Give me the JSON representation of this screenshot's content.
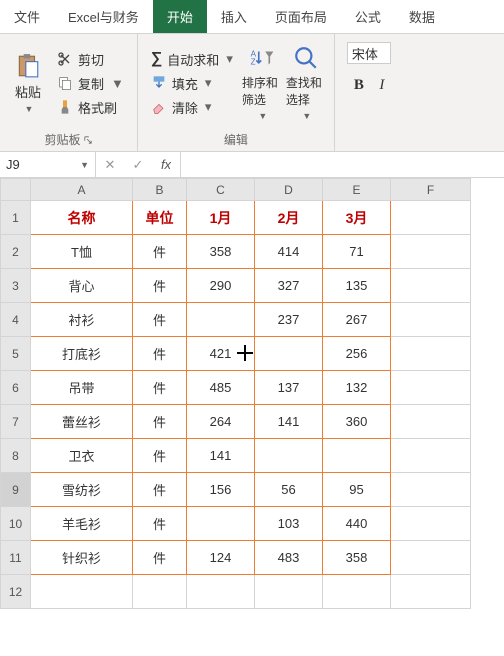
{
  "tabs": {
    "file": "文件",
    "excel_finance": "Excel与财务",
    "home": "开始",
    "insert": "插入",
    "page_layout": "页面布局",
    "formulas": "公式",
    "data": "数据"
  },
  "ribbon": {
    "clipboard": {
      "paste": "粘贴",
      "cut": "剪切",
      "copy": "复制",
      "format_painter": "格式刷",
      "label": "剪贴板"
    },
    "editing": {
      "autosum": "自动求和",
      "fill": "填充",
      "clear": "清除",
      "sort_filter": "排序和筛选",
      "find_select": "查找和选择",
      "label": "编辑"
    },
    "font": {
      "name": "宋体",
      "bold": "B",
      "italic": "I"
    }
  },
  "namebox": {
    "ref": "J9"
  },
  "columns": [
    "A",
    "B",
    "C",
    "D",
    "E",
    "F"
  ],
  "headers": {
    "name": "名称",
    "unit": "单位",
    "m1": "1月",
    "m2": "2月",
    "m3": "3月"
  },
  "rows": [
    {
      "n": "1"
    },
    {
      "n": "2"
    },
    {
      "n": "3"
    },
    {
      "n": "4"
    },
    {
      "n": "5"
    },
    {
      "n": "6"
    },
    {
      "n": "7"
    },
    {
      "n": "8"
    },
    {
      "n": "9"
    },
    {
      "n": "10"
    },
    {
      "n": "11"
    },
    {
      "n": "12"
    }
  ],
  "chart_data": {
    "type": "table",
    "columns": [
      "名称",
      "单位",
      "1月",
      "2月",
      "3月"
    ],
    "data": [
      [
        "T恤",
        "件",
        358,
        414,
        71
      ],
      [
        "背心",
        "件",
        290,
        327,
        135
      ],
      [
        "衬衫",
        "件",
        null,
        237,
        267
      ],
      [
        "打底衫",
        "件",
        421,
        null,
        256
      ],
      [
        "吊带",
        "件",
        485,
        137,
        132
      ],
      [
        "蕾丝衫",
        "件",
        264,
        141,
        360
      ],
      [
        "卫衣",
        "件",
        141,
        null,
        null
      ],
      [
        "雪纺衫",
        "件",
        156,
        56,
        95
      ],
      [
        "羊毛衫",
        "件",
        null,
        103,
        440
      ],
      [
        "针织衫",
        "件",
        124,
        483,
        358
      ]
    ]
  }
}
